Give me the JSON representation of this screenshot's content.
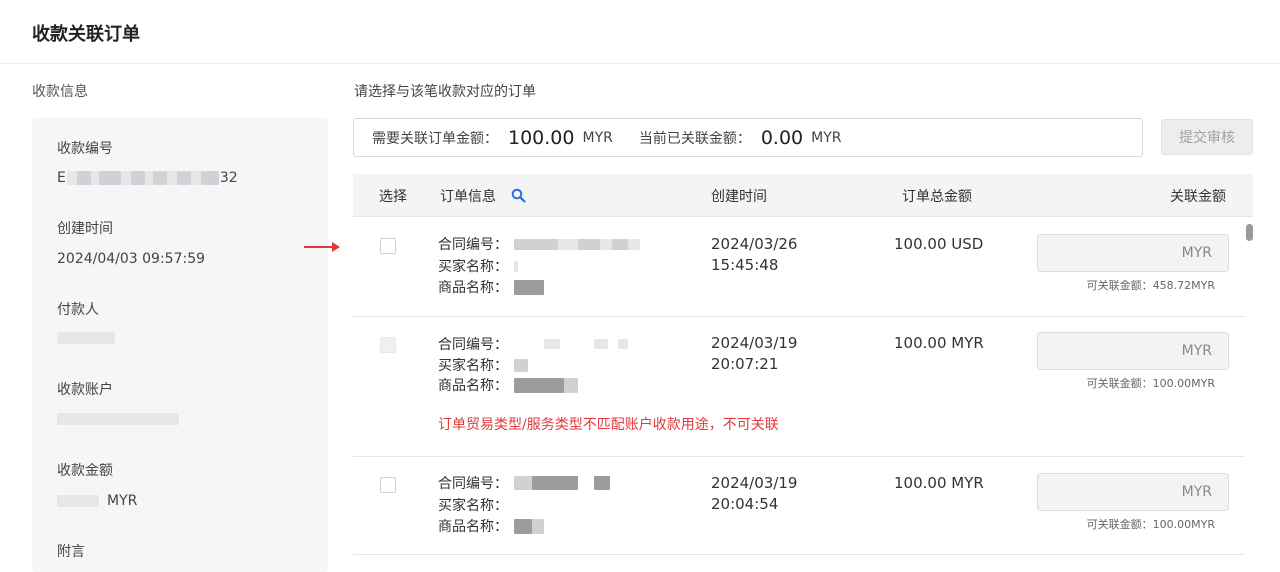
{
  "header": {
    "title": "收款关联订单"
  },
  "left": {
    "caption": "收款信息",
    "fields": [
      {
        "label": "收款编号",
        "value_prefix": "E",
        "value_suffix": "32"
      },
      {
        "label": "创建时间",
        "value": "2024/04/03 09:57:59"
      },
      {
        "label": "付款人"
      },
      {
        "label": "收款账户"
      },
      {
        "label": "收款金额",
        "currency": "MYR"
      },
      {
        "label": "附言"
      }
    ]
  },
  "right": {
    "caption": "请选择与该笔收款对应的订单",
    "summary": {
      "need_label": "需要关联订单金额：",
      "need_amount": "100.00",
      "need_currency": "MYR",
      "current_label": "当前已关联金额：",
      "current_amount": "0.00",
      "current_currency": "MYR"
    },
    "submit_label": "提交审核",
    "columns": [
      "选择",
      "订单信息",
      "创建时间",
      "订单总金额",
      "关联金额"
    ],
    "field_labels": [
      "合同编号：",
      "买家名称：",
      "商品名称："
    ],
    "rows": [
      {
        "date": "2024/03/26",
        "time": "15:45:48",
        "total": "100.00 USD",
        "input_placeholder": "MYR",
        "available": "可关联金额：458.72MYR"
      },
      {
        "date": "2024/03/19",
        "time": "20:07:21",
        "total": "100.00 MYR",
        "input_placeholder": "MYR",
        "available": "可关联金额：100.00MYR",
        "warning": "订单贸易类型/服务类型不匹配账户收款用途，不可关联"
      },
      {
        "date": "2024/03/19",
        "time": "20:04:54",
        "total": "100.00 MYR",
        "input_placeholder": "MYR",
        "available": "可关联金额：100.00MYR"
      }
    ]
  },
  "colors": {
    "warning": "#e3393c",
    "arrow": "#e3393c"
  },
  "icons": {
    "search": "search-icon",
    "arrow": "arrow-right-icon"
  }
}
